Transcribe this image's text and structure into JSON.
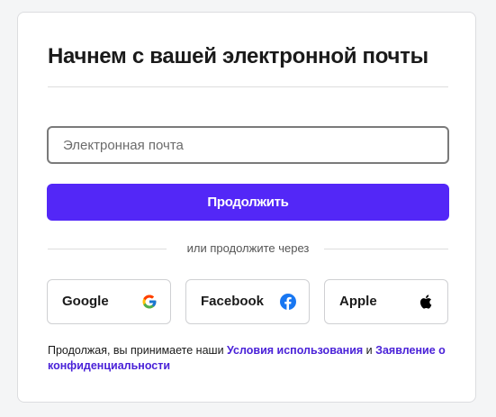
{
  "card": {
    "title": "Начнем с вашей электронной почты"
  },
  "email": {
    "placeholder": "Электронная почта",
    "value": ""
  },
  "continue_label": "Продолжить",
  "divider_text": "или продолжите через",
  "social": [
    {
      "label": "Google",
      "icon": "google-icon"
    },
    {
      "label": "Facebook",
      "icon": "facebook-icon"
    },
    {
      "label": "Apple",
      "icon": "apple-icon"
    }
  ],
  "legal": {
    "prefix": "Продолжая, вы принимаете наши ",
    "terms_link": "Условия использования",
    "conjunction": " и ",
    "privacy_link": "Заявление о конфиденциальности"
  },
  "colors": {
    "accent": "#5327f7",
    "link": "#4a22d8",
    "facebook": "#1877f2"
  }
}
